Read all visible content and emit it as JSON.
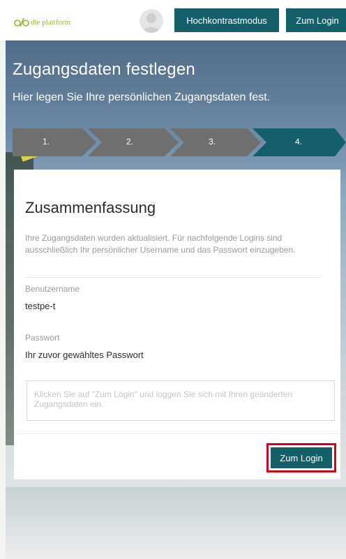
{
  "header": {
    "logo_text": "die plattform",
    "contrast_button": "Hochkontrastmodus",
    "login_button": "Zum Login"
  },
  "hero": {
    "title": "Zugangsdaten festlegen",
    "subtitle": "Hier legen Sie Ihre persönlichen Zugangsdaten fest."
  },
  "steps": [
    {
      "label": "1.",
      "state": "done"
    },
    {
      "label": "2.",
      "state": "done"
    },
    {
      "label": "3.",
      "state": "done"
    },
    {
      "label": "4.",
      "state": "active"
    }
  ],
  "summary": {
    "title": "Zusammenfassung",
    "description": "Ihre Zugangsdaten wurden aktualisiert. Für nachfolgende Logins sind ausschließlich Ihr persönlicher Username und das Passwort einzugeben.",
    "username_label": "Benutzername",
    "username_value": "testpe-t",
    "password_label": "Passwort",
    "password_value": "Ihr zuvor gewähltes Passwort",
    "info_text": "Klicken Sie auf \"Zum Login\" und loggen Sie sich mit Ihren geänderten Zugangsdaten ein.",
    "login_button": "Zum Login"
  },
  "colors": {
    "accent": "#155f6b",
    "step_inactive": "#6f6f6f",
    "highlight": "#d0021b",
    "logo": "#9bb23a"
  },
  "icons": {
    "logo": "dp-logo-icon",
    "avatar": "user-avatar-icon"
  }
}
